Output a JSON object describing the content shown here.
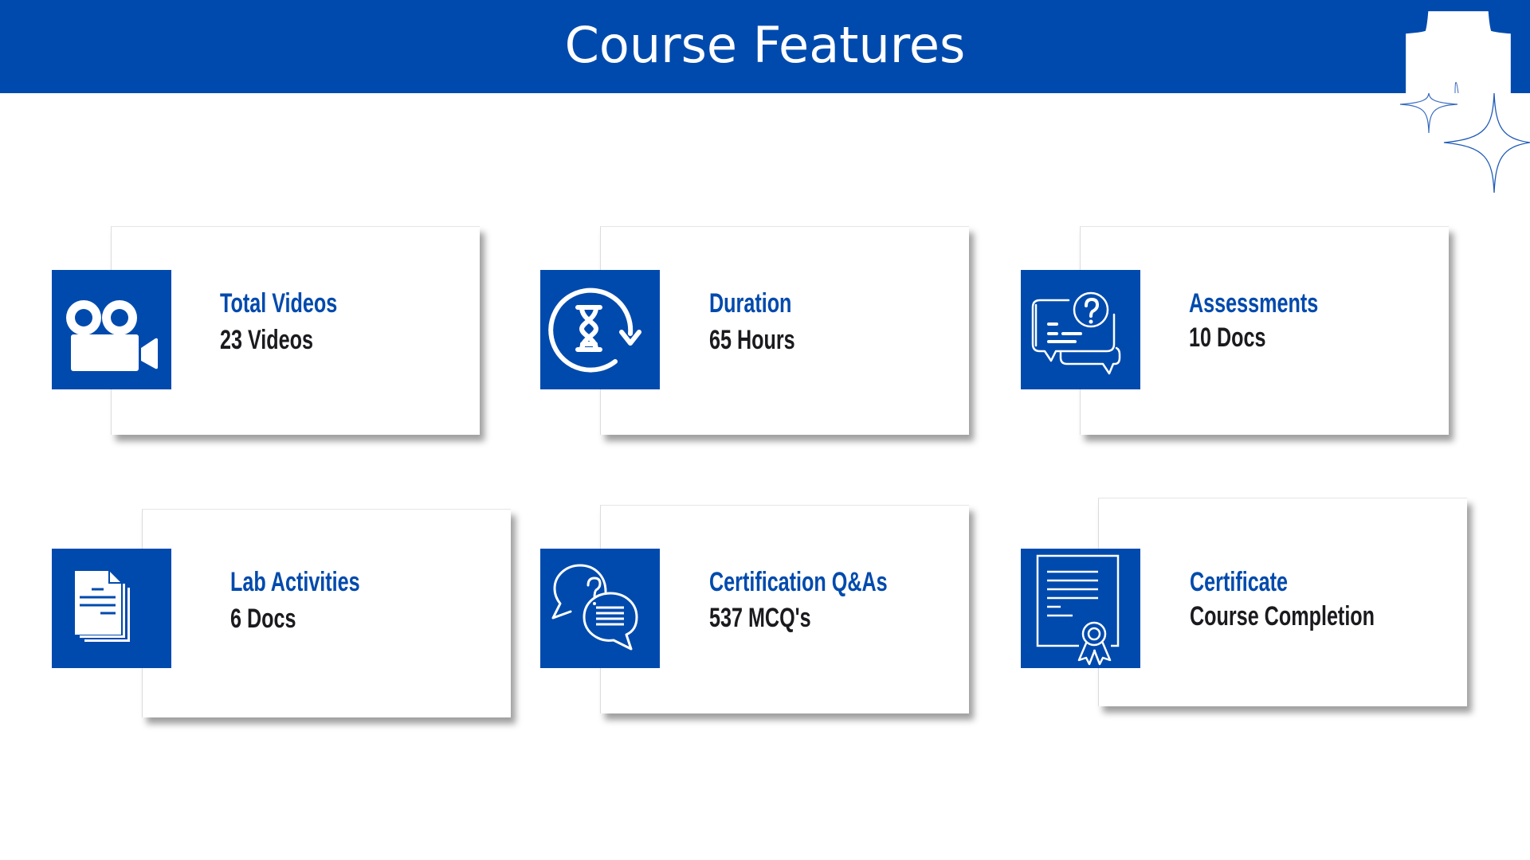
{
  "page": {
    "title": "Course Features",
    "brand_color": "#004AAD",
    "text_color": "#1b1b1f"
  },
  "features": [
    {
      "label": "Total Videos",
      "value": "23 Videos",
      "icon": "video-camera-icon"
    },
    {
      "label": "Duration",
      "value": "65 Hours",
      "icon": "hourglass-refresh-icon"
    },
    {
      "label": "Assessments",
      "value": "10 Docs",
      "icon": "question-chat-icon"
    },
    {
      "label": "Lab Activities",
      "value": "6 Docs",
      "icon": "documents-icon"
    },
    {
      "label": "Certification Q&As",
      "value": "537 MCQ's",
      "icon": "qa-speech-bubbles-icon"
    },
    {
      "label": "Certificate",
      "value": "Course Completion",
      "icon": "certificate-icon"
    }
  ]
}
